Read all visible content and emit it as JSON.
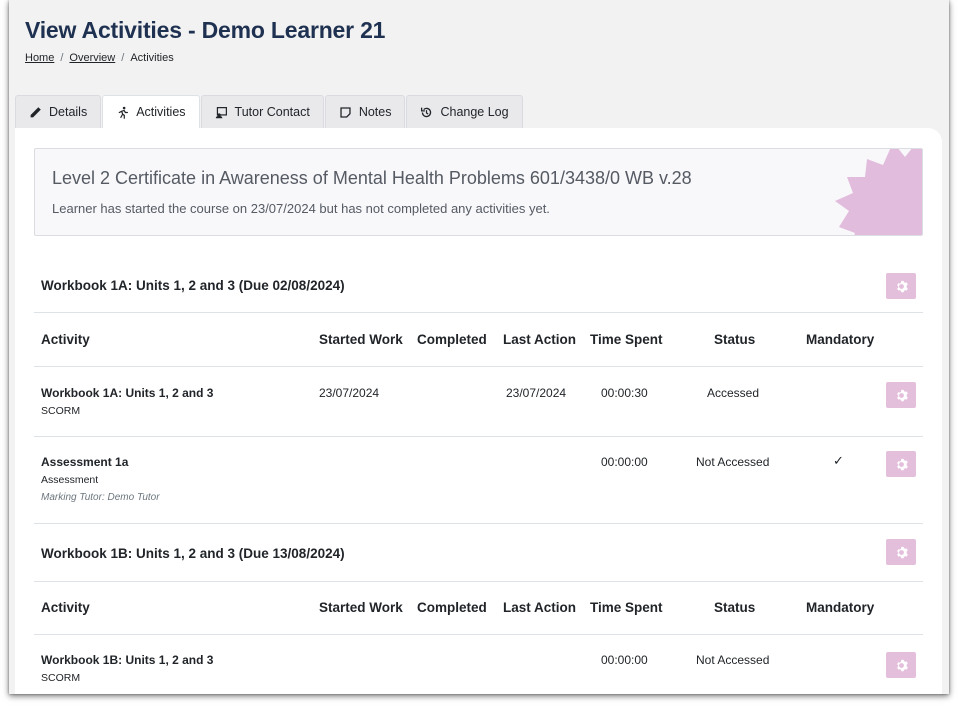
{
  "page": {
    "title": "View Activities - Demo Learner 21"
  },
  "breadcrumb": {
    "home": "Home",
    "overview": "Overview",
    "current": "Activities",
    "separator": "/"
  },
  "tabs": [
    {
      "label": "Details",
      "icon": "pencil-icon"
    },
    {
      "label": "Activities",
      "icon": "runner-icon",
      "active": true
    },
    {
      "label": "Tutor Contact",
      "icon": "contact-icon"
    },
    {
      "label": "Notes",
      "icon": "note-icon"
    },
    {
      "label": "Change Log",
      "icon": "history-icon"
    }
  ],
  "course": {
    "title": "Level 2 Certificate in Awareness of Mental Health Problems 601/3438/0 WB v.28",
    "message": "Learner has started the course on 23/07/2024 but has not completed any activities yet."
  },
  "columns": {
    "activity": "Activity",
    "started": "Started Work",
    "completed": "Completed",
    "last_action": "Last Action",
    "time_spent": "Time Spent",
    "status": "Status",
    "mandatory": "Mandatory"
  },
  "sections": [
    {
      "title": "Workbook 1A: Units 1, 2 and 3 (Due 02/08/2024)",
      "rows": [
        {
          "name": "Workbook 1A: Units 1, 2 and 3",
          "type": "SCORM",
          "tutor": "",
          "started": "23/07/2024",
          "completed": "",
          "last_action": "23/07/2024",
          "time_spent": "00:00:30",
          "status": "Accessed",
          "mandatory": ""
        },
        {
          "name": "Assessment 1a",
          "type": "Assessment",
          "tutor": "Marking Tutor: Demo Tutor",
          "started": "",
          "completed": "",
          "last_action": "",
          "time_spent": "00:00:00",
          "status": "Not Accessed",
          "mandatory": "✓"
        }
      ]
    },
    {
      "title": "Workbook 1B: Units 1, 2 and 3 (Due 13/08/2024)",
      "rows": [
        {
          "name": "Workbook 1B: Units 1, 2 and 3",
          "type": "SCORM",
          "tutor": "",
          "started": "",
          "completed": "",
          "last_action": "",
          "time_spent": "00:00:00",
          "status": "Not Accessed",
          "mandatory": ""
        }
      ]
    }
  ],
  "colors": {
    "title": "#1f3151",
    "gear_button": "#e4bfdc",
    "badge": "#e1bcdc",
    "gear_icon": "#ffffff"
  }
}
